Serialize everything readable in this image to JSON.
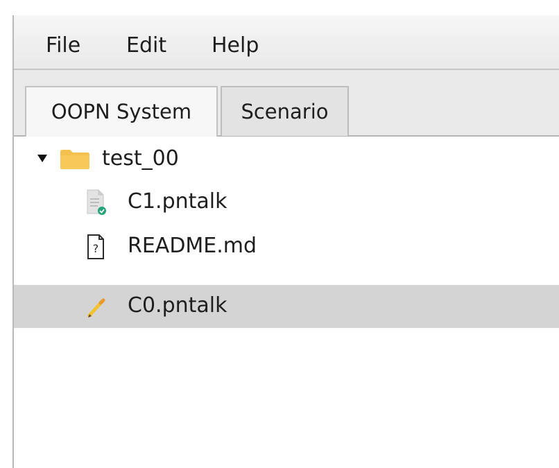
{
  "menubar": {
    "items": [
      {
        "label": "File"
      },
      {
        "label": "Edit"
      },
      {
        "label": "Help"
      }
    ]
  },
  "tabs": [
    {
      "label": "OOPN System",
      "active": true
    },
    {
      "label": "Scenario",
      "active": false
    }
  ],
  "tree": {
    "root": {
      "label": "test_00",
      "expanded": true,
      "icon": "folder-icon"
    },
    "children": [
      {
        "label": "C1.pntalk",
        "icon": "file-check-icon",
        "selected": false
      },
      {
        "label": "README.md",
        "icon": "file-unknown-icon",
        "selected": false
      },
      {
        "label": "C0.pntalk",
        "icon": "pencil-icon",
        "selected": true
      }
    ]
  },
  "colors": {
    "folder": "#f4c04e",
    "check_badge": "#27a37a",
    "selection": "#d4d4d4",
    "pencil_body": "#f2c230"
  }
}
